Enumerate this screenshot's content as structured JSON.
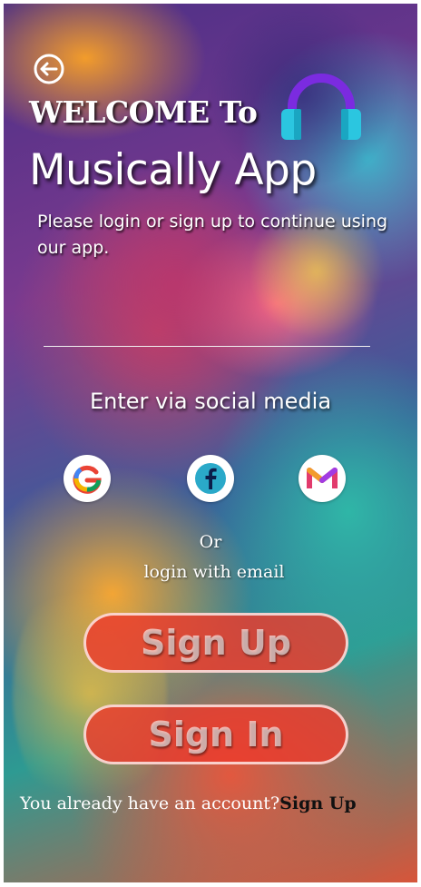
{
  "header": {
    "welcome": "WELCOME To",
    "app_name": "Musically App",
    "subtitle": "Please  login or sign up to continue using our app."
  },
  "icons": {
    "back": "back-arrow-icon",
    "headphones": "headphones-icon",
    "google": "google-icon",
    "facebook": "facebook-icon",
    "gmail": "gmail-icon"
  },
  "social": {
    "heading": "Enter via social media"
  },
  "separator": {
    "or": "Or",
    "email": "login with email"
  },
  "buttons": {
    "sign_up": "Sign Up",
    "sign_in": "Sign In"
  },
  "footer": {
    "question": "You already have an account?",
    "link": "Sign Up"
  },
  "colors": {
    "button_fill": "#ec3a2c",
    "headphone_band": "#7b2be0",
    "headphone_cups": "#2bc6e0"
  }
}
